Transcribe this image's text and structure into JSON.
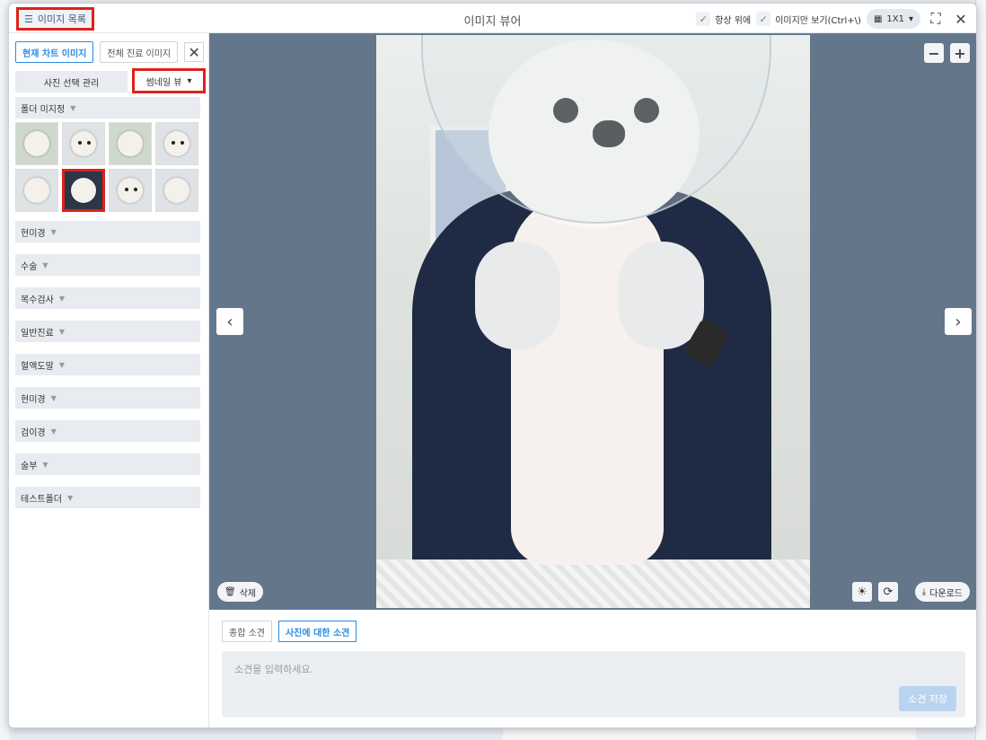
{
  "window": {
    "title": "이미지 뷰어",
    "list_button": "이미지 목록",
    "always_on_top": "항상 위에",
    "image_only": "이미지만 보기(Ctrl+\\)",
    "layout": "1X1"
  },
  "sidebar": {
    "tabs": [
      "현재 차트 이미지",
      "전체 진료 이미지"
    ],
    "manage_button": "사진 선택 관리",
    "view_select": "썸네일 뷰",
    "folders": [
      "폴더 미지정",
      "현미경",
      "수술",
      "복수검사",
      "일반진료",
      "혈액도말",
      "현미경",
      "검이경",
      "술부",
      "테스트폴더"
    ]
  },
  "viewer": {
    "delete": "삭제",
    "download": "다운로드"
  },
  "notes": {
    "tabs": [
      "종합 소견",
      "사진에 대한 소견"
    ],
    "placeholder": "소견을 입력하세요.",
    "save": "소견 저장"
  },
  "colors": {
    "accent": "#2b8ce0",
    "highlight": "#e0211b",
    "viewer_bg": "#647689"
  }
}
